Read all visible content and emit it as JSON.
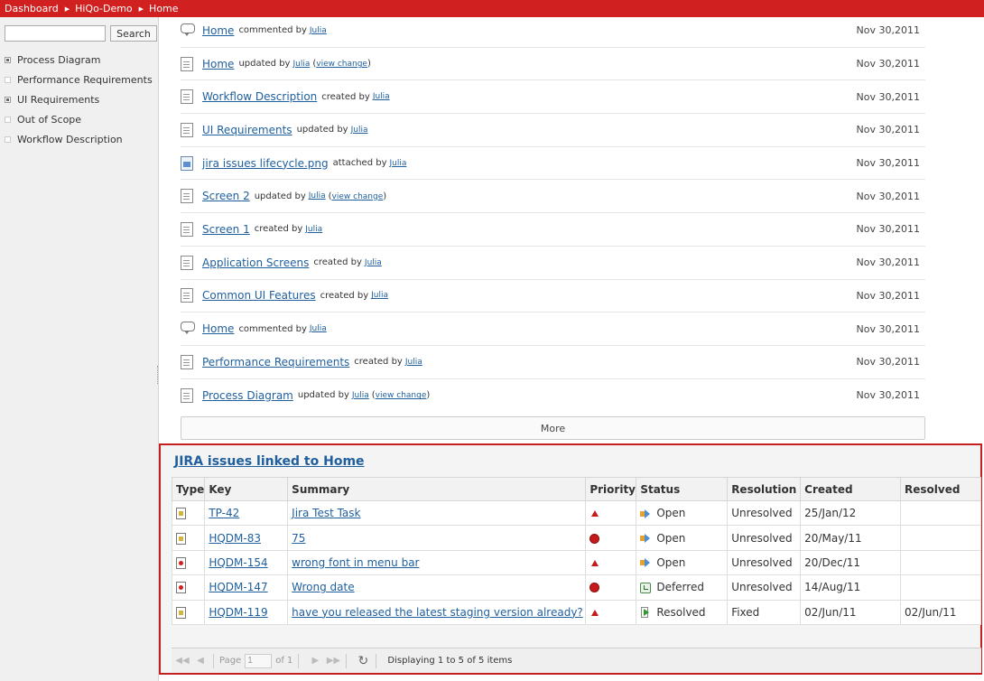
{
  "breadcrumbs": [
    "Dashboard",
    "HiQo-Demo",
    "Home"
  ],
  "sidebar": {
    "search_placeholder": "",
    "search_button": "Search",
    "items": [
      {
        "label": "Process Diagram",
        "expandable": true
      },
      {
        "label": "Performance Requirements",
        "expandable": false
      },
      {
        "label": "UI Requirements",
        "expandable": true
      },
      {
        "label": "Out of Scope",
        "expandable": false
      },
      {
        "label": "Workflow Description",
        "expandable": false
      }
    ]
  },
  "activity": [
    {
      "icon": "comment-icon",
      "title": "Home",
      "verb": "commented by",
      "user": "Julia",
      "change": "",
      "date": "Nov 30,2011"
    },
    {
      "icon": "page-icon",
      "title": "Home",
      "verb": "updated by",
      "user": "Julia",
      "change": "view change",
      "date": "Nov 30,2011"
    },
    {
      "icon": "page-icon",
      "title": "Workflow Description",
      "verb": "created by",
      "user": "Julia",
      "change": "",
      "date": "Nov 30,2011"
    },
    {
      "icon": "page-icon",
      "title": "UI Requirements",
      "verb": "updated by",
      "user": "Julia",
      "change": "",
      "date": "Nov 30,2011"
    },
    {
      "icon": "image-icon",
      "title": "jira issues lifecycle.png",
      "verb": "attached by",
      "user": "Julia",
      "change": "",
      "date": "Nov 30,2011"
    },
    {
      "icon": "page-icon",
      "title": "Screen 2",
      "verb": "updated by",
      "user": "Julia",
      "change": "view change",
      "date": "Nov 30,2011"
    },
    {
      "icon": "page-icon",
      "title": "Screen 1",
      "verb": "created by",
      "user": "Julia",
      "change": "",
      "date": "Nov 30,2011"
    },
    {
      "icon": "page-icon",
      "title": "Application Screens",
      "verb": "created by",
      "user": "Julia",
      "change": "",
      "date": "Nov 30,2011"
    },
    {
      "icon": "page-icon",
      "title": "Common UI Features",
      "verb": "created by",
      "user": "Julia",
      "change": "",
      "date": "Nov 30,2011"
    },
    {
      "icon": "comment-icon",
      "title": "Home",
      "verb": "commented by",
      "user": "Julia",
      "change": "",
      "date": "Nov 30,2011"
    },
    {
      "icon": "page-icon",
      "title": "Performance Requirements",
      "verb": "created by",
      "user": "Julia",
      "change": "",
      "date": "Nov 30,2011"
    },
    {
      "icon": "page-icon",
      "title": "Process Diagram",
      "verb": "updated by",
      "user": "Julia",
      "change": "view change",
      "date": "Nov 30,2011"
    }
  ],
  "more_label": "More",
  "jira": {
    "heading": "JIRA issues linked to Home",
    "columns": [
      "Type",
      "Key",
      "Summary",
      "Priority",
      "Status",
      "Resolution",
      "Created",
      "Resolved"
    ],
    "rows": [
      {
        "type": "task-icon",
        "key": "TP-42",
        "summary": "Jira Test Task",
        "priority": "major-priority-icon",
        "status_icon": "open-status-icon",
        "status": "Open",
        "resolution": "Unresolved",
        "created": "25/Jan/12",
        "resolved": ""
      },
      {
        "type": "task-icon",
        "key": "HQDM-83",
        "summary": "75",
        "priority": "blocker-priority-icon",
        "status_icon": "open-status-icon",
        "status": "Open",
        "resolution": "Unresolved",
        "created": "20/May/11",
        "resolved": ""
      },
      {
        "type": "bug-icon",
        "key": "HQDM-154",
        "summary": "wrong font in menu bar",
        "priority": "major-priority-icon",
        "status_icon": "open-status-icon",
        "status": "Open",
        "resolution": "Unresolved",
        "created": "20/Dec/11",
        "resolved": ""
      },
      {
        "type": "bug-icon",
        "key": "HQDM-147",
        "summary": "Wrong date",
        "priority": "blocker-priority-icon",
        "status_icon": "deferred-status-icon",
        "status": "Deferred",
        "resolution": "Unresolved",
        "created": "14/Aug/11",
        "resolved": ""
      },
      {
        "type": "task-icon",
        "key": "HQDM-119",
        "summary": "have you released the latest staging version already?",
        "priority": "major-priority-icon",
        "status_icon": "resolved-status-icon",
        "status": "Resolved",
        "resolution": "Fixed",
        "created": "02/Jun/11",
        "resolved": "02/Jun/11"
      }
    ],
    "pager": {
      "page_label": "Page",
      "page_value": "1",
      "of_label": "of 1",
      "display_text": "Displaying 1 to 5 of 5 items"
    }
  },
  "colors": {
    "topbar": "#d0201f",
    "link": "#1f5f9e",
    "panel_border": "#c52020"
  }
}
